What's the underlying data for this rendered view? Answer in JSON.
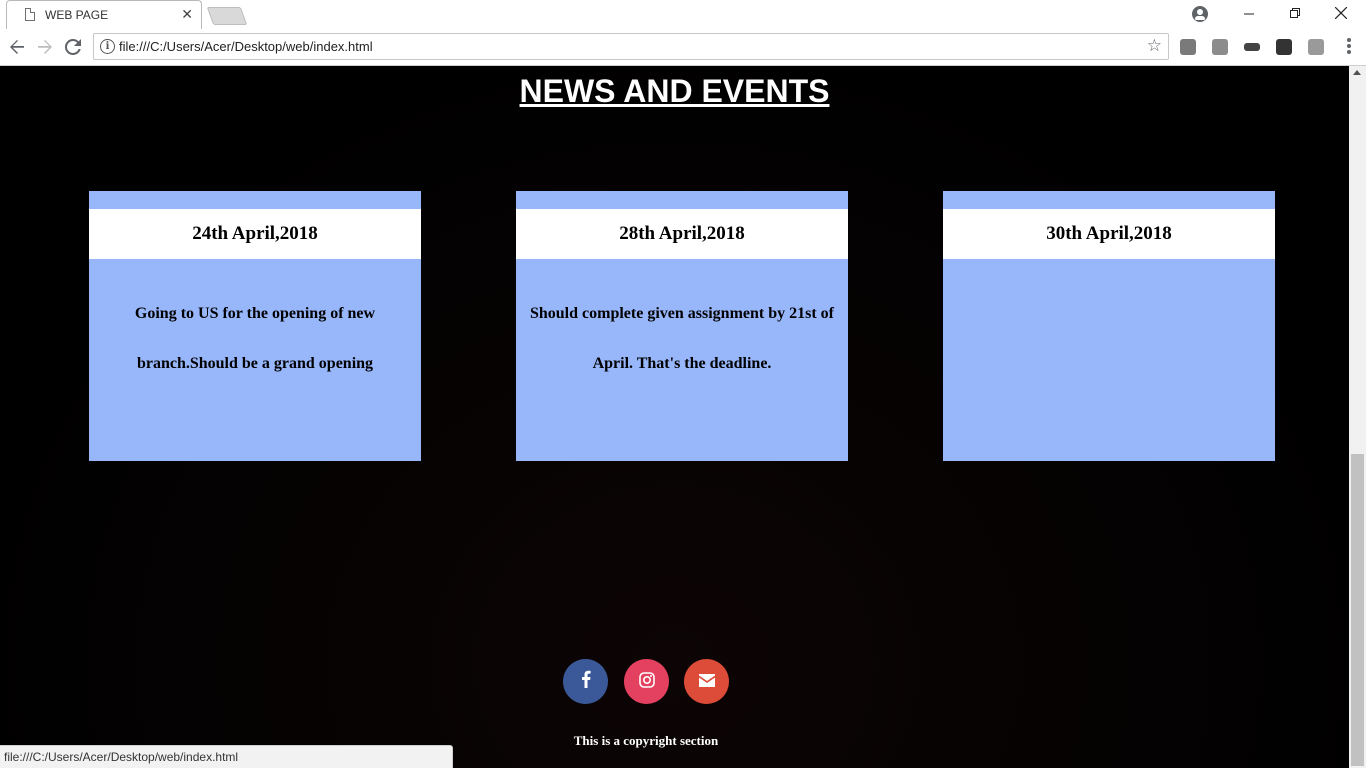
{
  "browser": {
    "tab_title": "WEB PAGE",
    "tab_close": "✕",
    "url": "file:///C:/Users/Acer/Desktop/web/index.html",
    "status_url": "file:///C:/Users/Acer/Desktop/web/index.html",
    "icons": [
      "back-icon",
      "forward-icon",
      "reload-icon",
      "info-icon",
      "star-icon",
      "menu-icon"
    ]
  },
  "page": {
    "heading": "NEWS AND EVENTS",
    "cards": [
      {
        "date": "24th April,2018",
        "description": "Going to US for the opening of new branch.Should be a grand opening"
      },
      {
        "date": "28th April,2018",
        "description": "Should complete given assignment by 21st of April. That's the deadline."
      },
      {
        "date": "30th April,2018",
        "description": ""
      }
    ],
    "social": {
      "facebook_color": "#3b5998",
      "instagram_color": "#e4405f",
      "email_color": "#dd4b39"
    },
    "copyright": "This is a copyright section"
  }
}
